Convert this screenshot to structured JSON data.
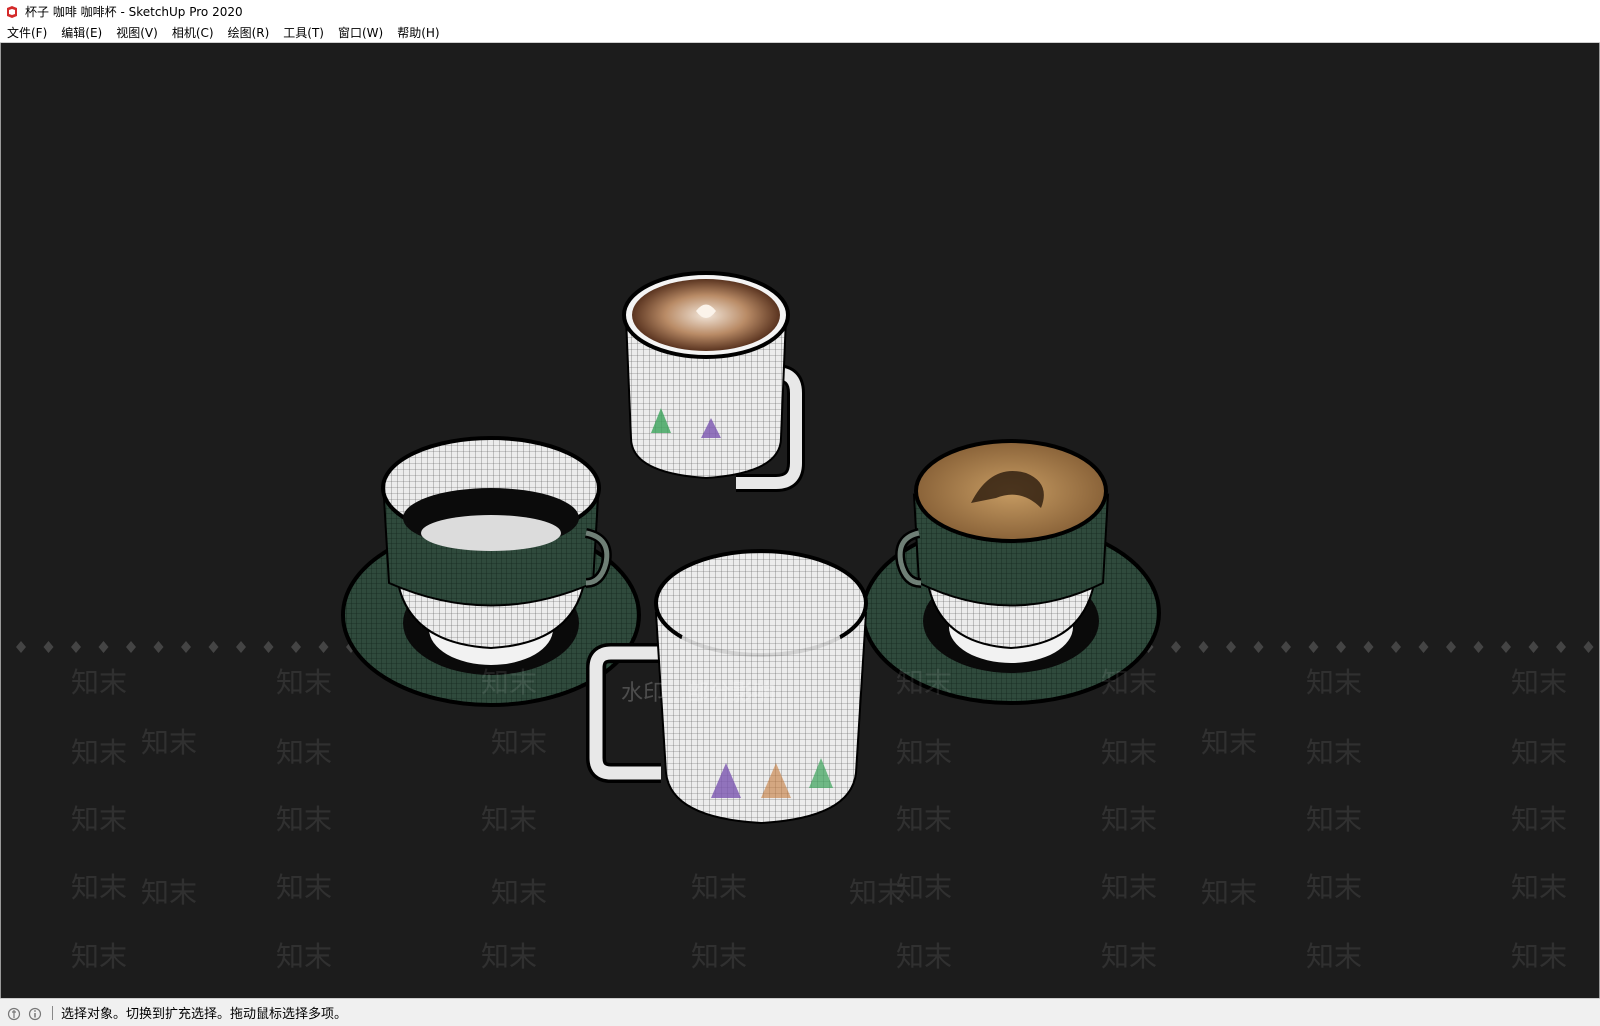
{
  "window": {
    "title": "杯子 咖啡 咖啡杯 - SketchUp Pro 2020",
    "app_icon": "sketchup-icon",
    "accent_color": "#d42a2a"
  },
  "menu": {
    "items": [
      {
        "label": "文件(F)"
      },
      {
        "label": "编辑(E)"
      },
      {
        "label": "视图(V)"
      },
      {
        "label": "相机(C)"
      },
      {
        "label": "绘图(R)"
      },
      {
        "label": "工具(T)"
      },
      {
        "label": "窗口(W)"
      },
      {
        "label": "帮助(H)"
      }
    ]
  },
  "viewport": {
    "background": "#1c1c1c",
    "cup_color": "#2f4a3c",
    "watermark_text": "知末",
    "banner_text": "水印…部分影响"
  },
  "status": {
    "icons": [
      "geo-location-icon",
      "info-icon"
    ],
    "message": "选择对象。切换到扩充选择。拖动鼠标选择多项。"
  }
}
